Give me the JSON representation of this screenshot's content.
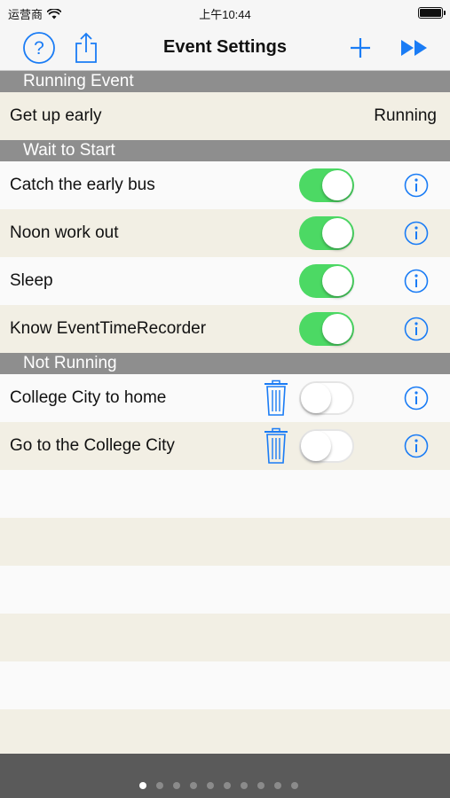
{
  "status_bar": {
    "carrier": "运营商",
    "time": "上午10:44",
    "battery_level": 1.0
  },
  "nav": {
    "title": "Event Settings",
    "icons": [
      "help-icon",
      "share-icon",
      "add-icon",
      "fast-forward-icon"
    ]
  },
  "colors": {
    "accent": "#1a7cf5",
    "toggle_on": "#4cd964",
    "section_header": "#8e8e8e",
    "row_cream": "#f2efe4",
    "bottom_bar": "#5a5a5a"
  },
  "sections": {
    "running": {
      "header": "Running Event",
      "rows": [
        {
          "label": "Get up early",
          "status": "Running"
        }
      ]
    },
    "waiting": {
      "header": "Wait to Start",
      "rows": [
        {
          "label": "Catch the early bus",
          "enabled": true
        },
        {
          "label": "Noon work out",
          "enabled": true
        },
        {
          "label": "Sleep",
          "enabled": true
        },
        {
          "label": "Know EventTimeRecorder",
          "enabled": true
        }
      ]
    },
    "not_running": {
      "header": "Not Running",
      "rows": [
        {
          "label": "College City to home",
          "enabled": false
        },
        {
          "label": "Go to the College City",
          "enabled": false
        }
      ]
    }
  },
  "page_control": {
    "pages": 10,
    "current": 1
  }
}
